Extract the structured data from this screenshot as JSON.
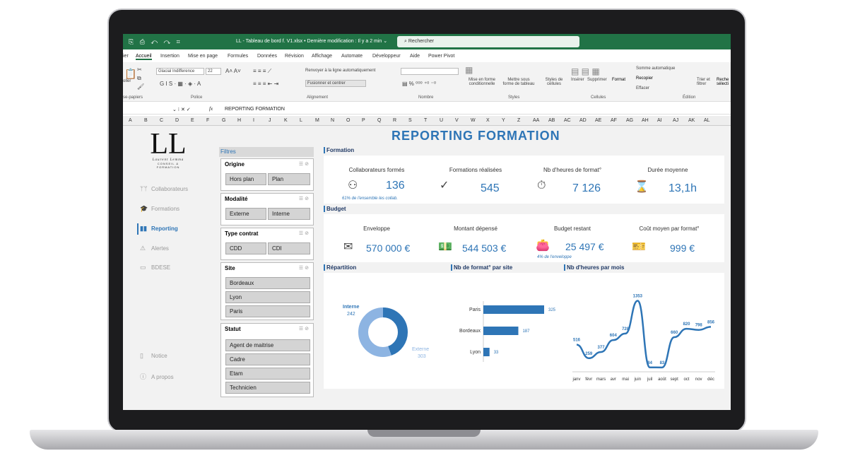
{
  "window": {
    "doc_title": "LL - Tableau de bord f. V1.xlsx • Dernière modification : Il y a 2 min ⌄",
    "search_placeholder": "Rechercher"
  },
  "menu": [
    "ier",
    "Accueil",
    "Insertion",
    "Mise en page",
    "Formules",
    "Données",
    "Révision",
    "Affichage",
    "Automate",
    "Développeur",
    "Aide",
    "Power Pivot"
  ],
  "ribbon": {
    "font_name": "Glacial Indifference",
    "font_size": "22",
    "wrap_text": "Renvoyer à la ligne automatiquement",
    "merge": "Fusionner et centrer",
    "cond_format": "Mise en forme conditionnelle",
    "table_format": "Mettre sous forme de tableau",
    "cell_styles": "Styles de cellules",
    "insert": "Insérer",
    "delete": "Supprimer",
    "format": "Format",
    "autosum": "Somme automatique",
    "fill": "Recopier",
    "clear": "Effacer",
    "sort": "Trier et filtrer",
    "find": "Reche sélecti",
    "groups": {
      "clipboard": "se-papiers",
      "font": "Police",
      "alignment": "Alignement",
      "number": "Nombre",
      "styles": "Styles",
      "cells": "Cellules",
      "editing": "Édition"
    },
    "paste": "oller"
  },
  "formula": {
    "fx": "fx",
    "content": "REPORTING  FORMATION"
  },
  "columns": [
    "A",
    "B",
    "C",
    "D",
    "E",
    "F",
    "G",
    "H",
    "I",
    "J",
    "K",
    "L",
    "M",
    "N",
    "O",
    "P",
    "Q",
    "R",
    "S",
    "T",
    "U",
    "V",
    "W",
    "X",
    "Y",
    "Z",
    "AA",
    "AB",
    "AC",
    "AD",
    "AE",
    "AF",
    "AG",
    "AH",
    "AI",
    "AJ",
    "AK",
    "AL"
  ],
  "logo": {
    "letters": "LL",
    "script": "Laurent Lemma",
    "tagline": "CONSEIL & FORMATION"
  },
  "nav": {
    "collaborateurs": "Collaborateurs",
    "formations": "Formations",
    "reporting": "Reporting",
    "alertes": "Alertes",
    "bdese": "BDESE",
    "notice": "Notice",
    "apropos": "A propos"
  },
  "title": "REPORTING  FORMATION",
  "filters": {
    "label": "Filtres",
    "origine": {
      "title": "Origine",
      "items": [
        "Hors plan",
        "Plan"
      ]
    },
    "modalite": {
      "title": "Modalité",
      "items": [
        "Externe",
        "Interne"
      ]
    },
    "type_contrat": {
      "title": "Type contrat",
      "items": [
        "CDD",
        "CDI"
      ]
    },
    "site": {
      "title": "Site",
      "items": [
        "Bordeaux",
        "Lyon",
        "Paris"
      ]
    },
    "statut": {
      "title": "Statut",
      "items": [
        "Agent de maitrise",
        "Cadre",
        "Etam",
        "Technicien"
      ]
    }
  },
  "formation": {
    "label": "Formation",
    "collab_label": "Collaborateurs formés",
    "collab_value": "136",
    "collab_note": "61% de l'ensemble les collab.",
    "formations_label": "Formations réalisées",
    "formations_value": "545",
    "hours_label": "Nb d'heures de format°",
    "hours_value": "7 126",
    "duration_label": "Durée moyenne",
    "duration_value": "13,1h"
  },
  "budget": {
    "label": "Budget",
    "envelope_label": "Enveloppe",
    "envelope_value": "570 000 €",
    "spent_label": "Montant dépensé",
    "spent_value": "544 503 €",
    "remaining_label": "Budget restant",
    "remaining_value": "25 497 €",
    "remaining_note": "4% de l'enveloppe",
    "avg_cost_label": "Coût moyen par format°",
    "avg_cost_value": "999 €"
  },
  "colors": {
    "accent": "#2e75b6",
    "light": "#8db4e2",
    "excel": "#217346"
  },
  "chart_data": [
    {
      "type": "pie",
      "title": "Répartition",
      "categories": [
        "Interne",
        "Externe"
      ],
      "values": [
        242,
        303
      ]
    },
    {
      "type": "bar",
      "title": "Nb de format° par site",
      "categories": [
        "Paris",
        "Bordeaux",
        "Lyon"
      ],
      "values": [
        325,
        187,
        33
      ]
    },
    {
      "type": "line",
      "title": "Nb d'heures par mois",
      "categories": [
        "janv",
        "févr",
        "mars",
        "avr",
        "mai",
        "juin",
        "juil",
        "août",
        "sept",
        "oct",
        "nov",
        "déc"
      ],
      "values": [
        516,
        259,
        377,
        604,
        728,
        1353,
        84,
        83,
        660,
        820,
        798,
        856
      ]
    }
  ]
}
